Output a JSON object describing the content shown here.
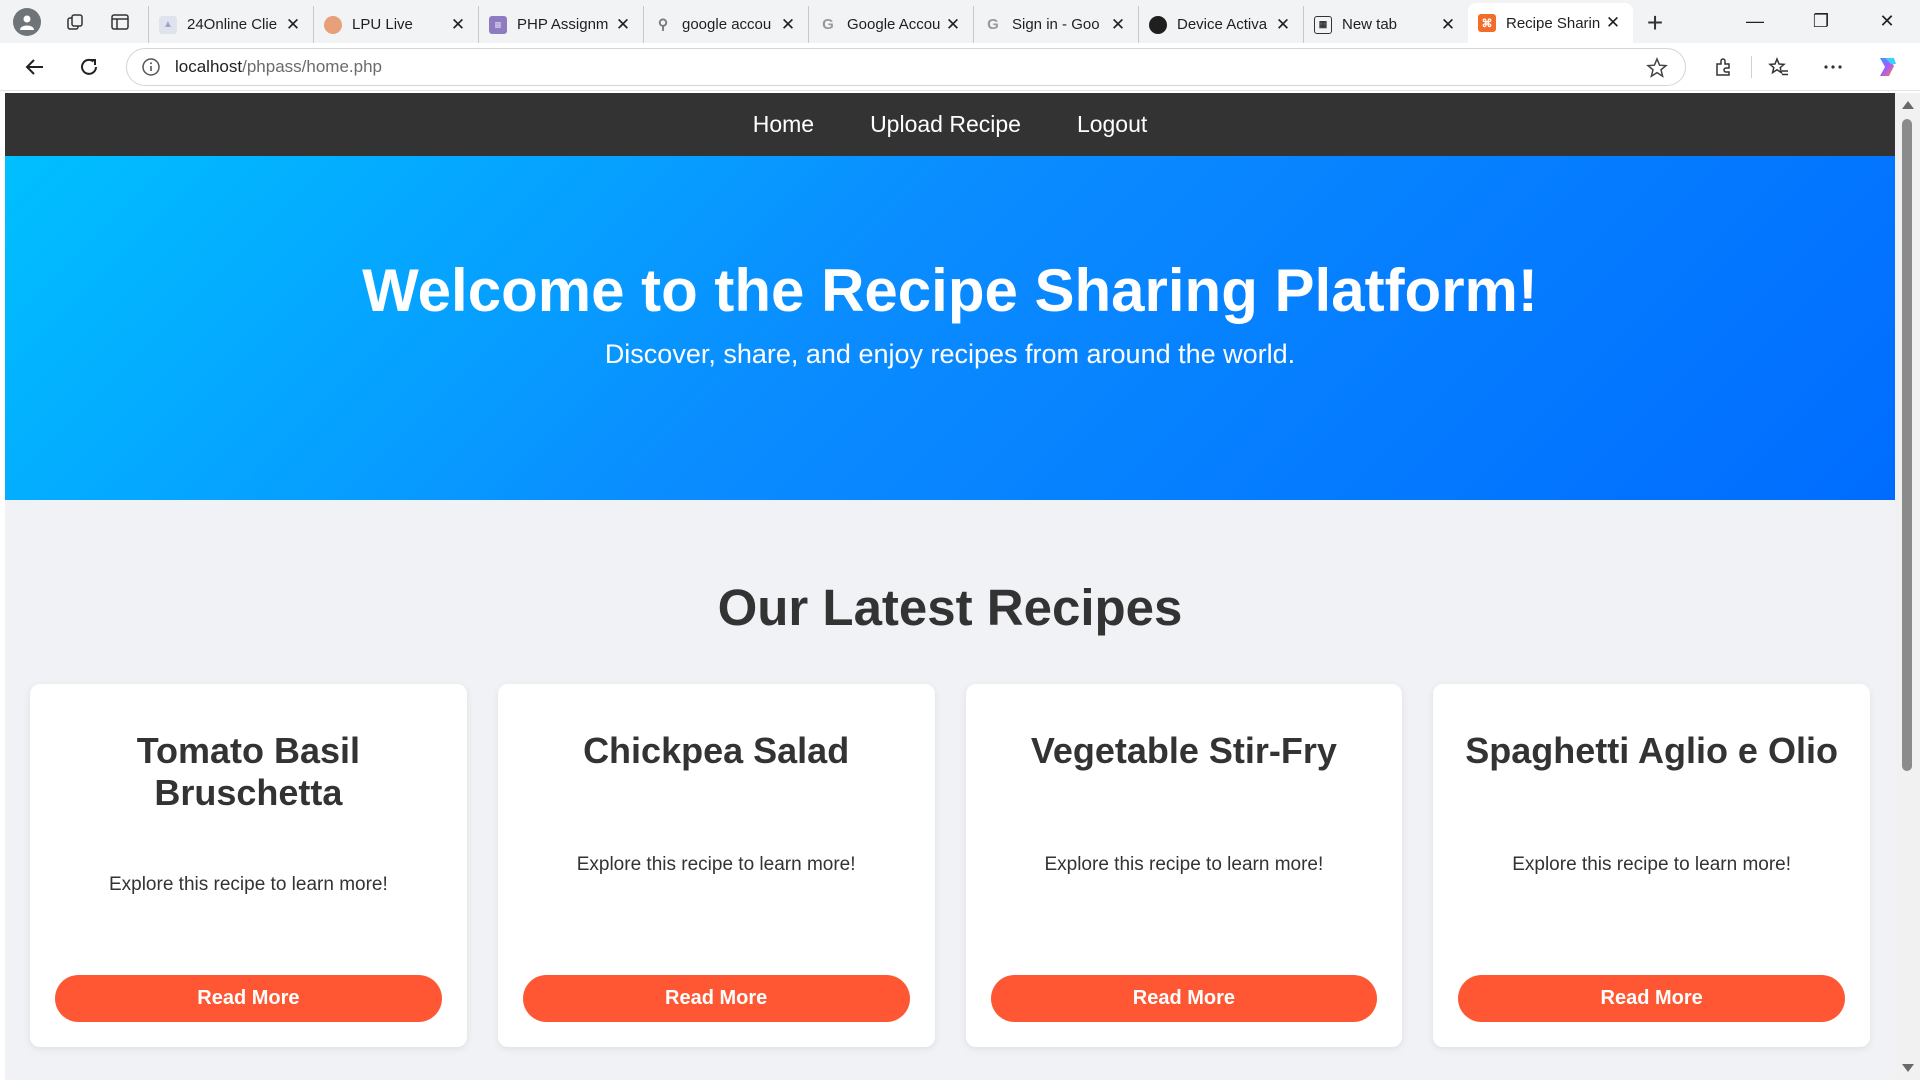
{
  "browser": {
    "tabs": [
      {
        "title": "24Online Clie",
        "favicon_color": "#9aa6c4",
        "favicon_glyph": "▲"
      },
      {
        "title": "LPU Live",
        "favicon_color": "#e8a07a",
        "favicon_glyph": "◔"
      },
      {
        "title": "PHP Assignm",
        "favicon_color": "#8e7cc3",
        "favicon_glyph": "≡"
      },
      {
        "title": "google accou",
        "favicon_color": "#f1f3f4",
        "favicon_glyph": "🔍"
      },
      {
        "title": "Google Accou",
        "favicon_color": "#f1f3f4",
        "favicon_glyph": "G"
      },
      {
        "title": "Sign in - Goo",
        "favicon_color": "#f1f3f4",
        "favicon_glyph": "G"
      },
      {
        "title": "Device Activa",
        "favicon_color": "#1f1f1f",
        "favicon_glyph": "●"
      },
      {
        "title": "New tab",
        "favicon_color": "#f1f3f4",
        "favicon_glyph": "▦"
      }
    ],
    "active_tab": {
      "title": "Recipe Sharin",
      "favicon_color": "#f36c2a",
      "favicon_glyph": "⌘"
    },
    "url_host": "localhost",
    "url_path": "/phpass/home.php"
  },
  "site": {
    "nav": {
      "home": "Home",
      "upload": "Upload Recipe",
      "logout": "Logout"
    },
    "hero": {
      "title": "Welcome to the Recipe Sharing Platform!",
      "subtitle": "Discover, share, and enjoy recipes from around the world."
    },
    "section_title": "Our Latest Recipes",
    "recipes": [
      {
        "title": "Tomato Basil Bruschetta",
        "description": "Explore this recipe to learn more!",
        "button": "Read More"
      },
      {
        "title": "Chickpea Salad",
        "description": "Explore this recipe to learn more!",
        "button": "Read More"
      },
      {
        "title": "Vegetable Stir-Fry",
        "description": "Explore this recipe to learn more!",
        "button": "Read More"
      },
      {
        "title": "Spaghetti Aglio e Olio",
        "description": "Explore this recipe to learn more!",
        "button": "Read More"
      }
    ]
  },
  "colors": {
    "nav_bg": "#333333",
    "hero_gradient_start": "#00c0ff",
    "hero_gradient_end": "#006cff",
    "button": "#ff5733",
    "page_bg": "#f0f2f5"
  }
}
